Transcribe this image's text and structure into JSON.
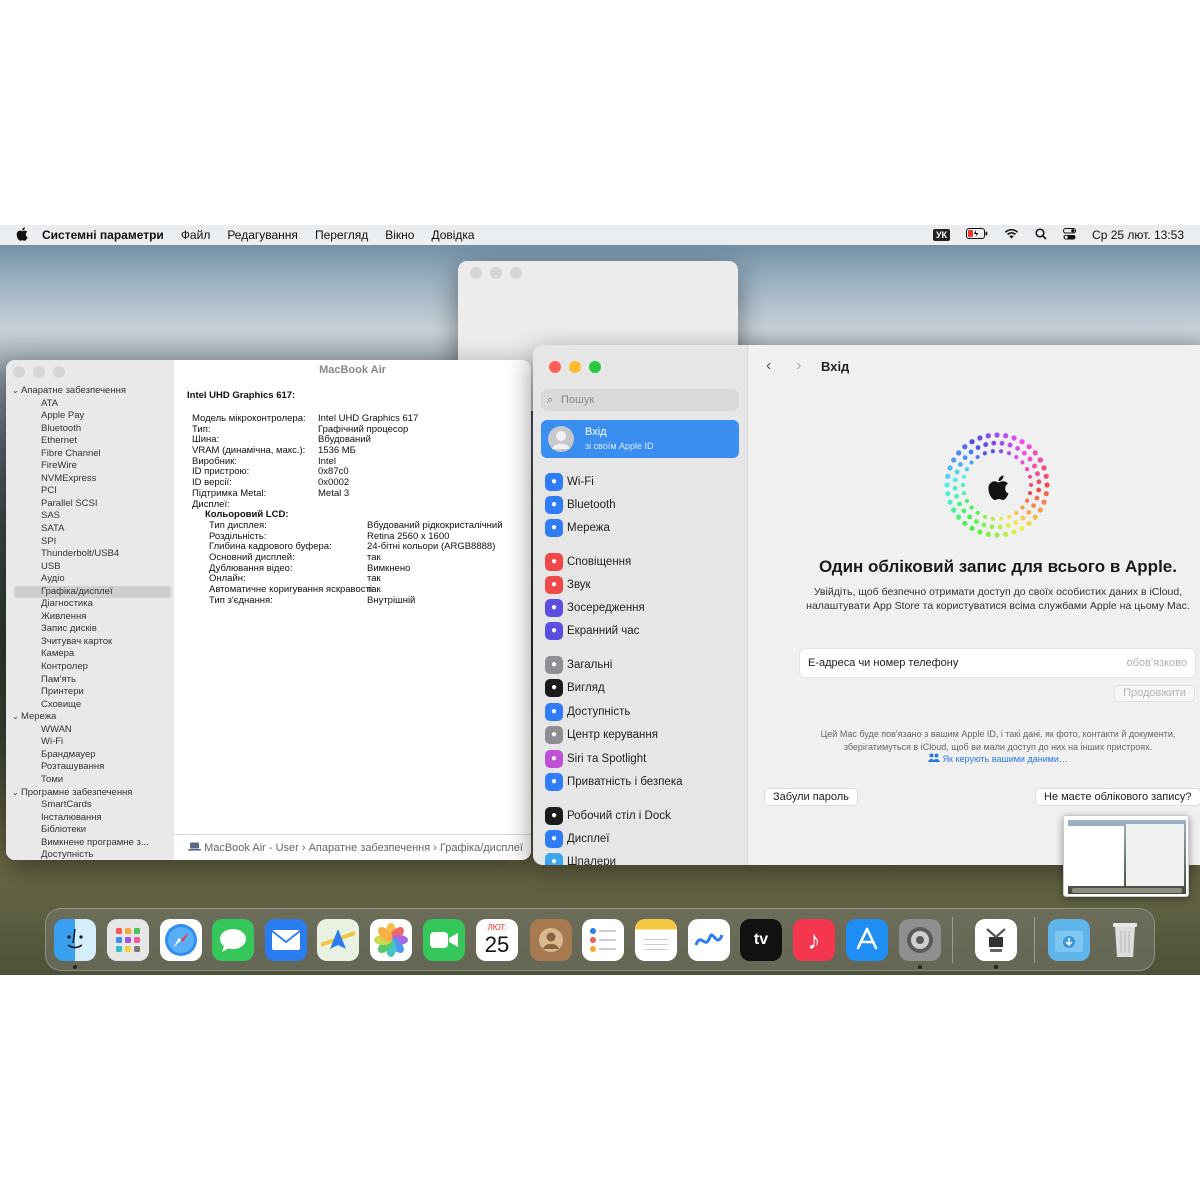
{
  "menubar": {
    "app_name": "Системні параметри",
    "menus": [
      "Файл",
      "Редагування",
      "Перегляд",
      "Вікно",
      "Довідка"
    ],
    "input_source": "УК",
    "datetime": "Ср 25 лют.  13:53"
  },
  "sysinfo": {
    "window_title": "MacBook Air",
    "sidebar": [
      {
        "label": "Апаратне забезпечення",
        "kind": "group"
      },
      {
        "label": "ATA",
        "kind": "item"
      },
      {
        "label": "Apple Pay",
        "kind": "item"
      },
      {
        "label": "Bluetooth",
        "kind": "item"
      },
      {
        "label": "Ethernet",
        "kind": "item"
      },
      {
        "label": "Fibre Channel",
        "kind": "item"
      },
      {
        "label": "FireWire",
        "kind": "item"
      },
      {
        "label": "NVMExpress",
        "kind": "item"
      },
      {
        "label": "PCI",
        "kind": "item"
      },
      {
        "label": "Parallel SCSI",
        "kind": "item"
      },
      {
        "label": "SAS",
        "kind": "item"
      },
      {
        "label": "SATA",
        "kind": "item"
      },
      {
        "label": "SPI",
        "kind": "item"
      },
      {
        "label": "Thunderbolt/USB4",
        "kind": "item"
      },
      {
        "label": "USB",
        "kind": "item"
      },
      {
        "label": "Аудіо",
        "kind": "item"
      },
      {
        "label": "Графіка/дисплеї",
        "kind": "item",
        "selected": true
      },
      {
        "label": "Діагностика",
        "kind": "item"
      },
      {
        "label": "Живлення",
        "kind": "item"
      },
      {
        "label": "Запис дисків",
        "kind": "item"
      },
      {
        "label": "Зчитувач карток",
        "kind": "item"
      },
      {
        "label": "Камера",
        "kind": "item"
      },
      {
        "label": "Контролер",
        "kind": "item"
      },
      {
        "label": "Пам'ять",
        "kind": "item"
      },
      {
        "label": "Принтери",
        "kind": "item"
      },
      {
        "label": "Сховище",
        "kind": "item"
      },
      {
        "label": "Мережа",
        "kind": "group"
      },
      {
        "label": "WWAN",
        "kind": "item"
      },
      {
        "label": "Wi-Fi",
        "kind": "item"
      },
      {
        "label": "Брандмауер",
        "kind": "item"
      },
      {
        "label": "Розташування",
        "kind": "item"
      },
      {
        "label": "Томи",
        "kind": "item"
      },
      {
        "label": "Програмне забезпечення",
        "kind": "group"
      },
      {
        "label": "SmartCards",
        "kind": "item"
      },
      {
        "label": "Інсталювання",
        "kind": "item"
      },
      {
        "label": "Бібліотеки",
        "kind": "item"
      },
      {
        "label": "Вимкнене програмне з...",
        "kind": "item"
      },
      {
        "label": "Доступність",
        "kind": "item"
      }
    ],
    "heading": "Intel UHD Graphics 617:",
    "props": [
      [
        "Модель мікроконтролера:",
        "Intel UHD Graphics 617"
      ],
      [
        "Тип:",
        "Графічний процесор"
      ],
      [
        "Шина:",
        "Вбудований"
      ],
      [
        "VRAM (динамічна, макс.):",
        "1536 МБ"
      ],
      [
        "Виробник:",
        "Intel"
      ],
      [
        "ID пристрою:",
        "0x87c0"
      ],
      [
        "ID версії:",
        "0x0002"
      ],
      [
        "Підтримка Metal:",
        "Metal 3"
      ],
      [
        "Дисплеї:",
        ""
      ]
    ],
    "display_heading": "Кольоровий LCD:",
    "display_props": [
      [
        "Тип дисплея:",
        "Вбудований рідкокристалічний"
      ],
      [
        "Роздільність:",
        "Retina 2560 x 1600"
      ],
      [
        "Глибина кадрового буфера:",
        "24-бітні кольори (ARGB8888)"
      ],
      [
        "Основний дисплей:",
        "так"
      ],
      [
        "Дублювання відео:",
        "Вимкнено"
      ],
      [
        "Онлайн:",
        "так"
      ],
      [
        "Автоматичне коригування яскравості:",
        "так"
      ],
      [
        "Тип з'єднання:",
        "Внутрішній"
      ]
    ],
    "path": "MacBook Air - User  ›  Апаратне забезпечення  ›  Графіка/дисплеї"
  },
  "settings": {
    "search_placeholder": "Пошук",
    "account": {
      "title": "Вхід",
      "subtitle": "зі своїм Apple ID"
    },
    "sidebar": [
      {
        "label": "Wi-Fi",
        "color": "#2f7cf6",
        "icon": "wifi-icon"
      },
      {
        "label": "Bluetooth",
        "color": "#2f7cf6",
        "icon": "bluetooth-icon"
      },
      {
        "label": "Мережа",
        "color": "#2f7cf6",
        "icon": "globe-icon"
      },
      {
        "label": "Сповіщення",
        "color": "#f04848",
        "icon": "bell-icon"
      },
      {
        "label": "Звук",
        "color": "#f04848",
        "icon": "speaker-icon"
      },
      {
        "label": "Зосередження",
        "color": "#5b4ee0",
        "icon": "moon-icon"
      },
      {
        "label": "Екранний час",
        "color": "#5b4ee0",
        "icon": "hourglass-icon"
      },
      {
        "label": "Загальні",
        "color": "#8e8e93",
        "icon": "gear-icon"
      },
      {
        "label": "Вигляд",
        "color": "#1c1c1e",
        "icon": "appearance-icon"
      },
      {
        "label": "Доступність",
        "color": "#2f7cf6",
        "icon": "accessibility-icon"
      },
      {
        "label": "Центр керування",
        "color": "#8e8e93",
        "icon": "control-center-icon"
      },
      {
        "label": "Siri та Spotlight",
        "color": "#c04fd8",
        "icon": "siri-icon"
      },
      {
        "label": "Приватність і безпека",
        "color": "#2f7cf6",
        "icon": "hand-icon"
      },
      {
        "label": "Робочий стіл і Dock",
        "color": "#1c1c1e",
        "icon": "dock-icon"
      },
      {
        "label": "Дисплеї",
        "color": "#2f7cf6",
        "icon": "display-icon"
      },
      {
        "label": "Шпалери",
        "color": "#3aa5f0",
        "icon": "wallpaper-icon"
      }
    ],
    "page_title": "Вхід",
    "headline": "Один обліковий запис для всього в Apple.",
    "description": "Увійдіть, щоб безпечно отримати доступ до своїх особистих даних в iCloud, налаштувати App Store та користуватися всіма службами Apple на цьому Mac.",
    "email_label": "Е-адреса чи номер телефону",
    "email_required": "обов'язково",
    "continue": "Продовжити",
    "note": "Цей Mac буде пов'язано з вашим Apple ID, і такі дані, як фото, контакти й документи, зберігатимуться в iCloud, щоб ви мали доступ до них на інших пристроях.",
    "note_link": "Як керують вашими даними…",
    "forgot": "Забули пароль",
    "no_account": "Не маєте облікового запису?"
  },
  "dock": {
    "calendar_month": "ЛЮТ.",
    "calendar_day": "25",
    "tv_label": "tv",
    "apps": [
      "finder",
      "launchpad",
      "safari",
      "messages",
      "mail",
      "maps",
      "photos",
      "facetime",
      "calendar",
      "contacts",
      "reminders",
      "notes",
      "freeform",
      "tv",
      "music",
      "app-store",
      "system-settings",
      "system-information",
      "downloads",
      "trash"
    ]
  }
}
